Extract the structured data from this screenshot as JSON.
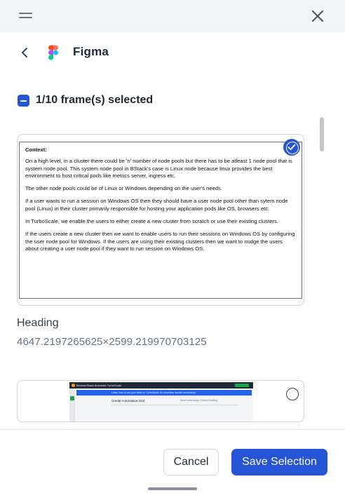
{
  "app": {
    "name": "Figma"
  },
  "selection": {
    "label": "1/10 frame(s) selected"
  },
  "frames": [
    {
      "name": "Heading",
      "dimensions": "4647.2197265625×2599.219970703125",
      "selected": true,
      "preview_paragraphs": [
        "Context:",
        "On a high level, in a cluster there could be 'n' number of node pools but there has to be atleast 1 node pool that is system node pool. This system node pool in BStack's case is Linux node because linux provides the best environment to host critical pods like metrics server, ingress etc.",
        "The other node pools could be of Linux or Windows depending on the user's needs.",
        "If a user wants to run a session on Windows OS then they should have a user node pool other than sytem node pool (Linux) in their cluster primarily responsible for hosting your application pods like OS, browsers etc.",
        "In TurboScale, we enable the users to either create a new cluster from scratch or use their existing clusters.",
        "If the users create a new cluster then we want to enable users to run their sessions on Windows OS by configuring the user node pool for Windows. If the users are using their existing clusters then we want to nudge the users about creating a user node pool if they want to run session on Windows OS."
      ]
    },
    {
      "selected": false,
      "preview": {
        "brand": "BrowserStack  Automate TurboScale",
        "banner": "Learn how to run your tests on TurboScale for seamless remote automation",
        "title": "Create Automation Grid",
        "tabs": "New Kubernetes   |   Select Existing"
      }
    }
  ],
  "buttons": {
    "cancel": "Cancel",
    "save": "Save Selection"
  },
  "colors": {
    "accent": "#2554d6",
    "topbar": "#f3f4f6"
  }
}
